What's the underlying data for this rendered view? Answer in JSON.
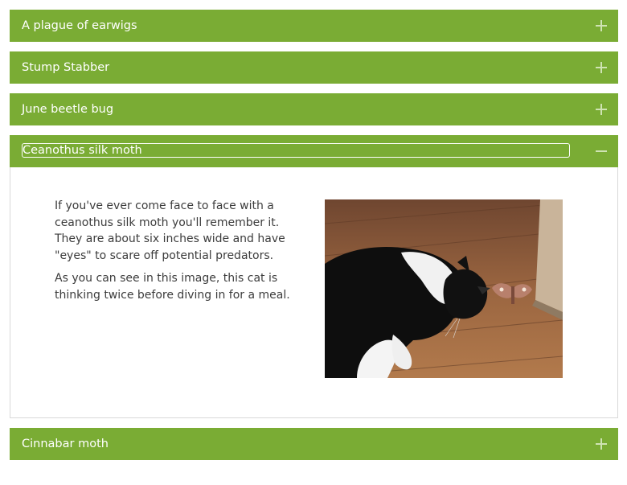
{
  "accordion": {
    "items": [
      {
        "title": "A plague of earwigs",
        "state": "collapsed",
        "icon": "plus-icon"
      },
      {
        "title": "Stump Stabber",
        "state": "collapsed",
        "icon": "plus-icon"
      },
      {
        "title": "June beetle bug",
        "state": "collapsed",
        "icon": "plus-icon"
      },
      {
        "title": "Ceanothus silk moth",
        "state": "expanded",
        "icon": "minus-icon",
        "paragraphs": [
          "If you've ever come face to face with a ceanothus silk moth you'll remember it. They are about six inches wide and have \"eyes\" to scare off potential predators.",
          "As you can see in this image, this cat is thinking twice before diving in for a meal."
        ]
      },
      {
        "title": "Cinnabar moth",
        "state": "collapsed",
        "icon": "plus-icon"
      }
    ]
  },
  "colors": {
    "header_bg": "#7aac34",
    "header_text": "#ffffff",
    "body_text": "#3c3c3c",
    "panel_border": "#d9d9d9"
  }
}
